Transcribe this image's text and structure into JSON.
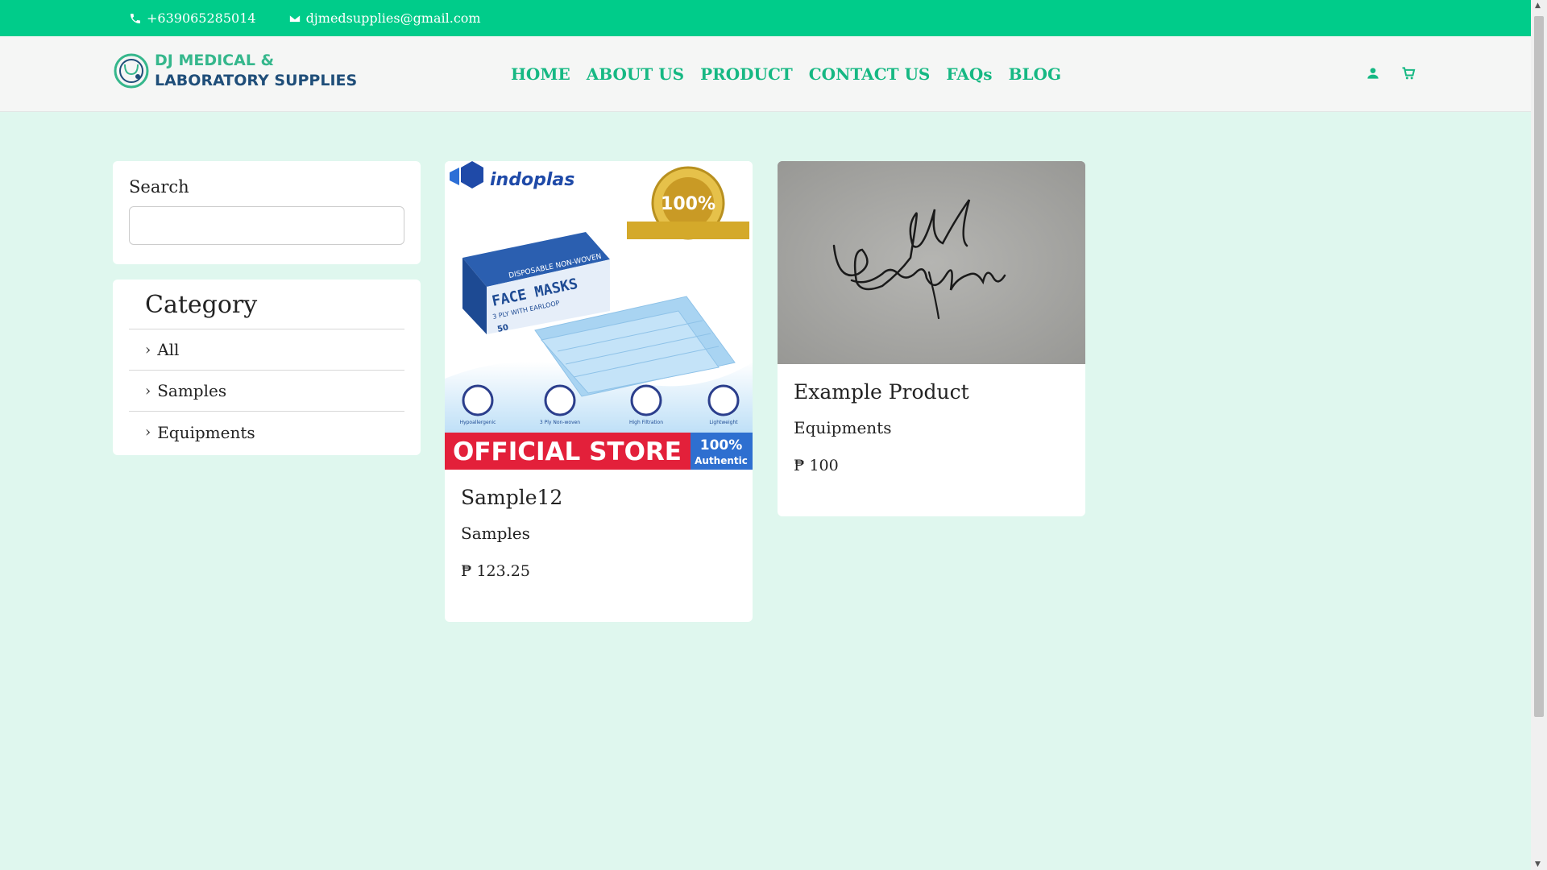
{
  "topbar": {
    "phone": "+639065285014",
    "email": "djmedsupplies@gmail.com"
  },
  "logo": {
    "line1": "DJ MEDICAL &",
    "line2": "LABORATORY SUPPLIES"
  },
  "nav": {
    "items": [
      {
        "label": "HOME"
      },
      {
        "label": "ABOUT US"
      },
      {
        "label": "PRODUCT"
      },
      {
        "label": "CONTACT US"
      },
      {
        "label": "FAQs"
      },
      {
        "label": "BLOG"
      }
    ],
    "icons": [
      "user-icon",
      "cart-icon"
    ]
  },
  "sidebar": {
    "search": {
      "label": "Search",
      "value": "",
      "placeholder": ""
    },
    "category": {
      "title": "Category",
      "items": [
        {
          "label": "All"
        },
        {
          "label": "Samples"
        },
        {
          "label": "Equipments"
        }
      ]
    }
  },
  "products": [
    {
      "name": "Sample12",
      "category": "Samples",
      "price": "₱ 123.25",
      "image": {
        "brand": "indoplas",
        "seal_text": "100%",
        "box_text_1": "DISPOSABLE NON-WOVEN",
        "box_text_2": "FACE MASKS",
        "box_text_3": "3 PLY WITH EARLOOP",
        "box_count": "50",
        "features": [
          "Hypoallergenic",
          "3 Ply Non-woven",
          "High Filtration",
          "Lightweight"
        ],
        "banner": "OFFICIAL STORE",
        "banner_badge_1": "100%",
        "banner_badge_2": "Authentic"
      }
    },
    {
      "name": "Example Product",
      "category": "Equipments",
      "price": "₱ 100",
      "image": {
        "description_icon": "signature-image"
      }
    }
  ],
  "colors": {
    "accent": "#00cc8a",
    "nav_text": "#16b883",
    "page_bg": "#dff7ee"
  }
}
